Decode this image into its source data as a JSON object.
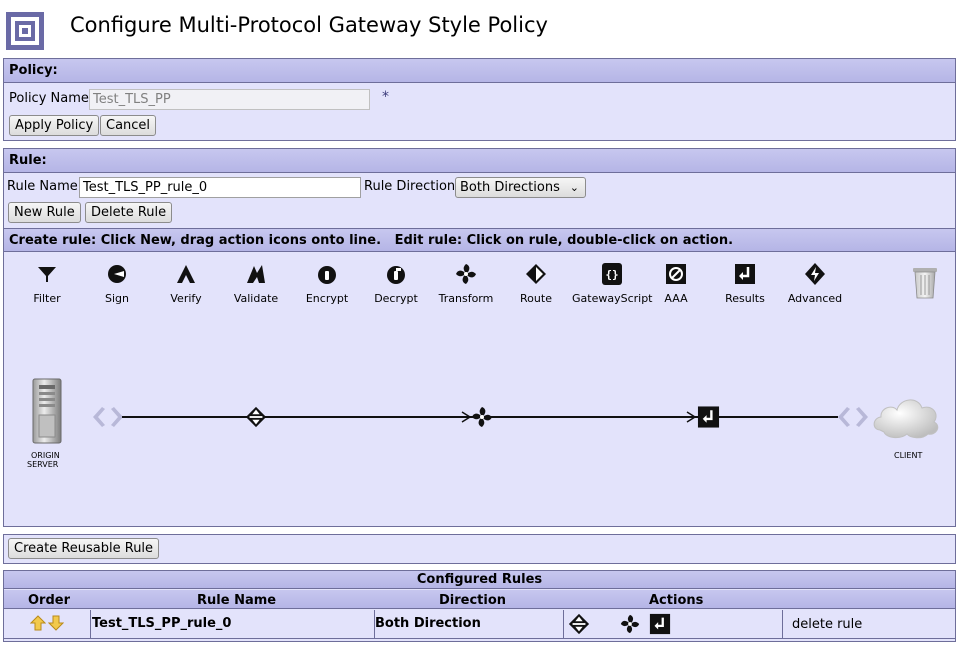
{
  "header": {
    "title": "Configure Multi-Protocol Gateway Style Policy"
  },
  "policy": {
    "section_title": "Policy:",
    "name_label": "Policy Name:",
    "name_value": "Test_TLS_PP",
    "required_marker": "*",
    "apply_label": "Apply Policy",
    "cancel_label": "Cancel"
  },
  "rule": {
    "section_title": "Rule:",
    "name_label": "Rule Name:",
    "name_value": "Test_TLS_PP_rule_0",
    "direction_label": "Rule Direction:",
    "direction_value": "Both Directions",
    "new_label": "New Rule",
    "delete_label": "Delete Rule",
    "instructions": "Create rule: Click New, drag action icons onto line.   Edit rule: Click on rule, double-click on action."
  },
  "palette": {
    "items": [
      {
        "label": "Filter",
        "icon": "filter-icon"
      },
      {
        "label": "Sign",
        "icon": "sign-icon"
      },
      {
        "label": "Verify",
        "icon": "verify-icon"
      },
      {
        "label": "Validate",
        "icon": "validate-icon"
      },
      {
        "label": "Encrypt",
        "icon": "encrypt-icon"
      },
      {
        "label": "Decrypt",
        "icon": "decrypt-icon"
      },
      {
        "label": "Transform",
        "icon": "transform-icon"
      },
      {
        "label": "Route",
        "icon": "route-icon"
      },
      {
        "label": "GatewayScript",
        "icon": "gatewayscript-icon"
      },
      {
        "label": "AAA",
        "icon": "aaa-icon"
      },
      {
        "label": "Results",
        "icon": "results-icon"
      },
      {
        "label": "Advanced",
        "icon": "advanced-icon"
      }
    ],
    "trash_icon": "trash-icon"
  },
  "canvas": {
    "origin_label_1": "ORIGIN",
    "origin_label_2": "SERVER",
    "client_label": "CLIENT",
    "actions": [
      "route-icon",
      "transform-icon",
      "results-icon"
    ]
  },
  "reusable": {
    "label": "Create Reusable Rule"
  },
  "configured": {
    "title": "Configured Rules",
    "headers": {
      "order": "Order",
      "name": "Rule Name",
      "direction": "Direction",
      "actions": "Actions"
    },
    "rows": [
      {
        "name": "Test_TLS_PP_rule_0",
        "direction": "Both Direction",
        "delete": "delete rule",
        "actions": [
          "route-icon",
          "transform-icon",
          "results-icon"
        ]
      }
    ]
  },
  "colors": {
    "panel_bg": "#e3e3fb",
    "bar_bg": "#b5b5e6",
    "border": "#6e6e9a",
    "accent": "#3a3a7a"
  }
}
